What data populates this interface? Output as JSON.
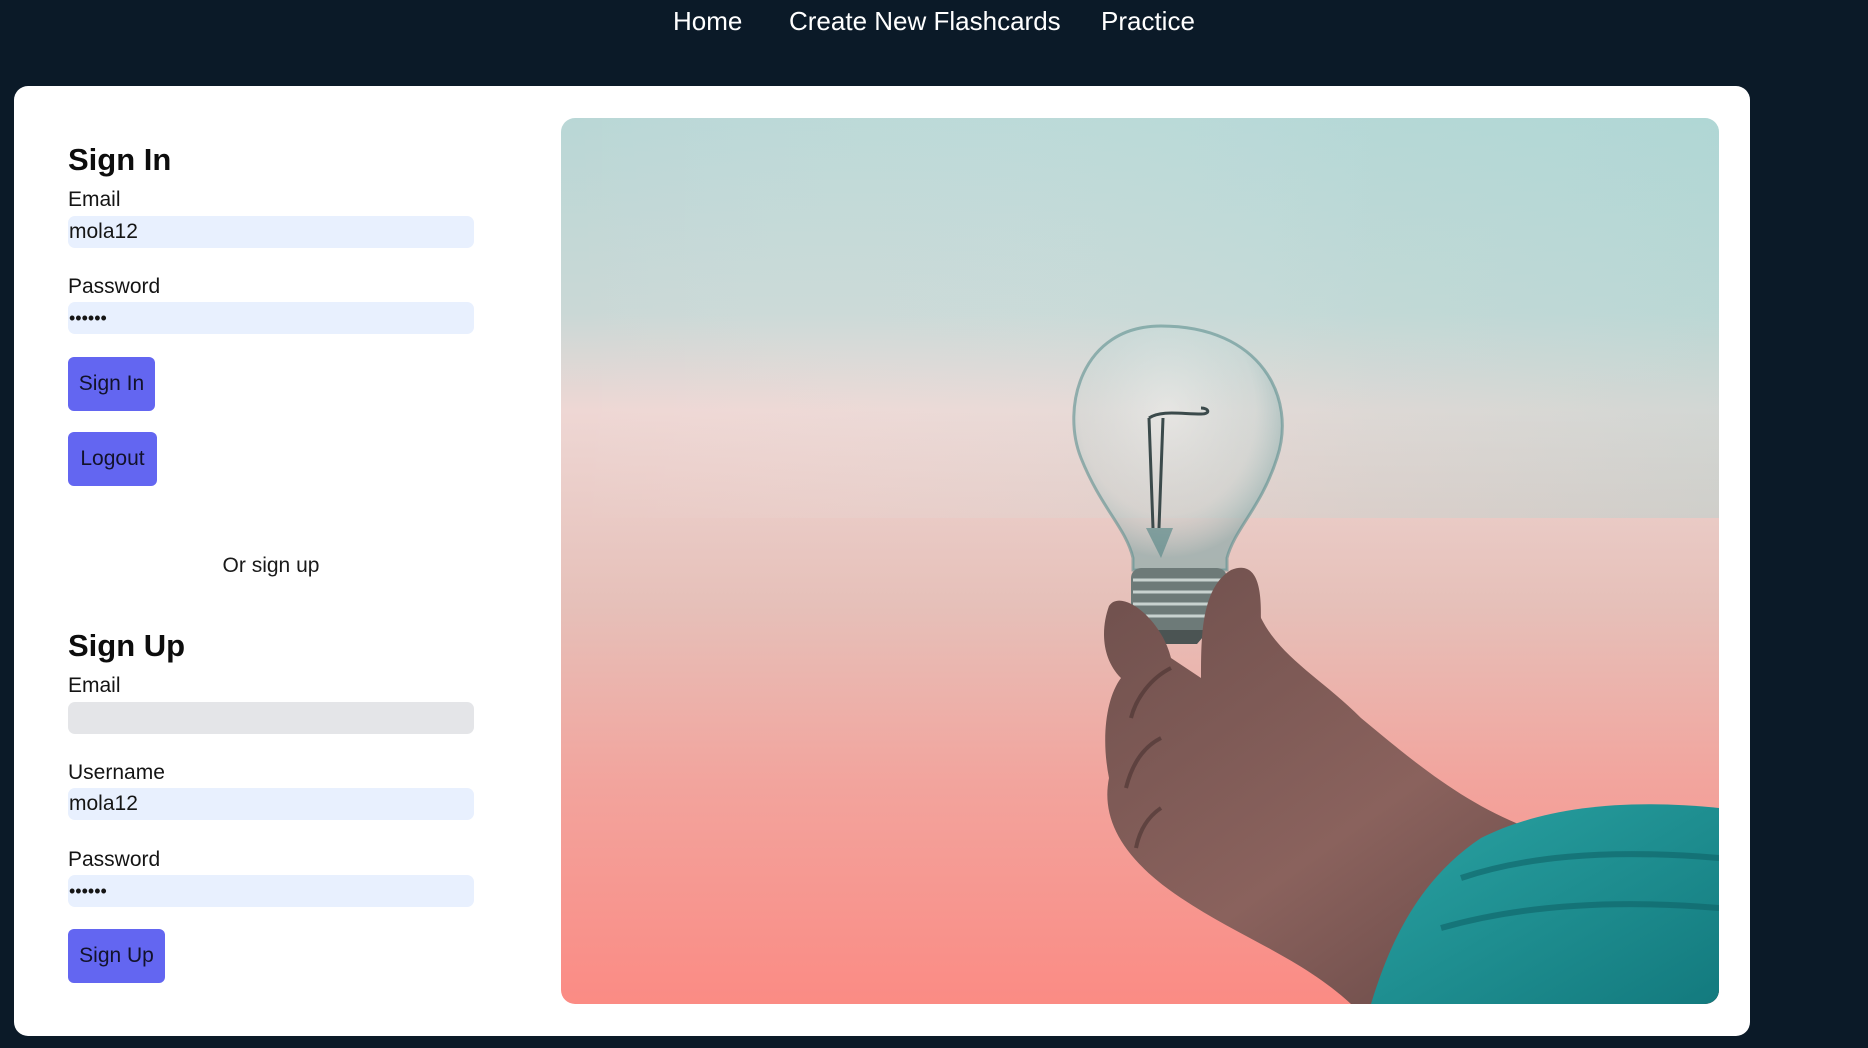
{
  "nav": {
    "home": "Home",
    "create": "Create New Flashcards",
    "practice": "Practice"
  },
  "signin": {
    "title": "Sign In",
    "email_label": "Email",
    "email_value": "mola12",
    "password_label": "Password",
    "password_value": "••••••",
    "signin_button": "Sign In",
    "logout_button": "Logout"
  },
  "divider_text": "Or sign up",
  "signup": {
    "title": "Sign Up",
    "email_label": "Email",
    "email_value": "",
    "username_label": "Username",
    "username_value": "mola12",
    "password_label": "Password",
    "password_value": "••••••",
    "signup_button": "Sign Up"
  },
  "hero": {
    "image": "hand-holding-lightbulb-image"
  },
  "colors": {
    "background": "#0b1a28",
    "card": "#ffffff",
    "button": "#6366f1",
    "input_autofill": "#e8f0fe",
    "input_empty": "#e4e5e8"
  }
}
